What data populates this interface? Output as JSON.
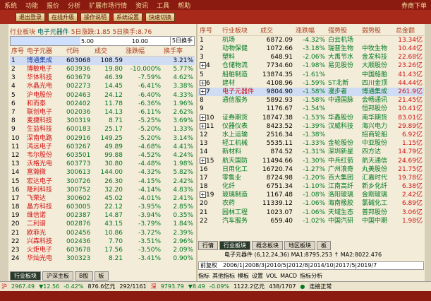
{
  "menubar": {
    "items": [
      "系统",
      "功能",
      "报价",
      "分析",
      "扩展市场行情",
      "资讯",
      "工具",
      "帮助"
    ],
    "right": "券商下单"
  },
  "toolbar": {
    "buttons": [
      "退出登录",
      "在线升级",
      "操作说明",
      "系统设置",
      "快速切换"
    ]
  },
  "left_panel": {
    "title_prefix": "行业板块",
    "title_name": "电子元器件",
    "title_stats": "5日涨跌:1.85 5日换手:8.76",
    "range_lo": "5.00",
    "range_hi": "10.00",
    "range_tag": "5日换手",
    "range_fill": 0.38,
    "headers": [
      "序号",
      "电子元器",
      "代码",
      "成交",
      "涨跌幅",
      "换手率"
    ],
    "rows": [
      [
        "1",
        "博通集成",
        "603068",
        "108.59",
        "",
        "3.21%"
      ],
      [
        "2",
        "博敏电子",
        "603936",
        "19.80",
        "-10.000%",
        "5.77%"
      ],
      [
        "3",
        "华体科技",
        "603679",
        "46.39",
        "-7.59%",
        "4.62%"
      ],
      [
        "4",
        "水晶光电",
        "002273",
        "14.45",
        "-6.41%",
        "3.38%"
      ],
      [
        "5",
        "沪电股份",
        "002463",
        "24.12",
        "-6.40%",
        "4.33%"
      ],
      [
        "6",
        "和而泰",
        "002402",
        "11.78",
        "-6.36%",
        "1.96%"
      ],
      [
        "7",
        "联创电子",
        "002036",
        "14.13",
        "-6.11%",
        "2.62%"
      ],
      [
        "8",
        "麦捷科技",
        "300319",
        "8.71",
        "-5.25%",
        "3.69%"
      ],
      [
        "9",
        "生益科技",
        "600183",
        "25.17",
        "-5.20%",
        "1.33%"
      ],
      [
        "10",
        "深南电路",
        "002916",
        "149.25",
        "-5.20%",
        "3.14%"
      ],
      [
        "11",
        "鸿远电子",
        "603267",
        "49.89",
        "-4.68%",
        "4.41%"
      ],
      [
        "12",
        "韦尔股份",
        "603501",
        "99.88",
        "-4.52%",
        "4.24%"
      ],
      [
        "13",
        "沃格光电",
        "603773",
        "30.80",
        "-4.48%",
        "1.98%"
      ],
      [
        "14",
        "富瀚微",
        "300613",
        "144.00",
        "-4.32%",
        "5.82%"
      ],
      [
        "15",
        "宏达电子",
        "300726",
        "26.30",
        "-4.15%",
        "2.42%"
      ],
      [
        "16",
        "隆利科技",
        "300752",
        "32.20",
        "-4.14%",
        "4.83%"
      ],
      [
        "17",
        "飞荣达",
        "300602",
        "45.02",
        "-4.01%",
        "2.41%"
      ],
      [
        "18",
        "晶方科技",
        "603005",
        "22.12",
        "-3.95%",
        "2.85%"
      ],
      [
        "19",
        "维信诺",
        "002387",
        "14.87",
        "-3.94%",
        "0.35%"
      ],
      [
        "20",
        "二利谱",
        "002876",
        "43.15",
        "-3.79%",
        "1.84%"
      ],
      [
        "21",
        "欧菲光",
        "002456",
        "10.86",
        "-3.72%",
        "2.39%"
      ],
      [
        "22",
        "兴森科技",
        "002436",
        "7.70",
        "-3.51%",
        "2.96%"
      ],
      [
        "23",
        "火炬电子",
        "603678",
        "17.56",
        "-3.50%",
        "2.09%"
      ],
      [
        "24",
        "华灿光电",
        "300323",
        "8.21",
        "-3.41%",
        "0.90%"
      ]
    ],
    "tabs": [
      "行业板块",
      "沪深主板",
      "B股",
      "板"
    ]
  },
  "right_panel": {
    "headers": [
      "序号",
      "行业板块",
      "成交",
      "涨跌幅",
      "强势股",
      "弱势股",
      "总金额"
    ],
    "rows": [
      [
        "1",
        "机场",
        "6872.09",
        "-4.32%",
        "白云机场",
        "",
        "13.34亿"
      ],
      [
        "2",
        "动物保健",
        "1072.66",
        "-3.18%",
        "瑞普生物",
        "中牧生物",
        "10.44亿"
      ],
      [
        "3",
        "塑料",
        "648.91",
        "-2.06%",
        "大禹节水",
        "金发科技",
        "22.68亿"
      ],
      [
        "4",
        "仓储物流",
        "7734.60",
        "-1.98%",
        "易见股份",
        "大顺股份",
        "23.26亿"
      ],
      [
        "5",
        "船舶制造",
        "13874.35",
        "-1.61%",
        "",
        "中国船舶",
        "41.43亿"
      ],
      [
        "6",
        "建材",
        "4108.96",
        "-1.59%",
        "ST北新",
        "四川金顶",
        "44.44亿"
      ],
      [
        "7",
        "电子元器件",
        "9804.90",
        "-1.58%",
        "漫步者",
        "博通集成",
        "261.9亿"
      ],
      [
        "8",
        "通信服务",
        "5892.93",
        "-1.58%",
        "中通国脉",
        "会畅通讯",
        "21.45亿"
      ],
      [
        "9",
        "",
        "1176.67",
        "-1.54%",
        "",
        "恒邦股份",
        "10.41亿"
      ],
      [
        "10",
        "证券期货",
        "18747.38",
        "-1.53%",
        "华鑫股份",
        "南华期货",
        "83.01亿"
      ],
      [
        "11",
        "仪器仪表",
        "8423.52",
        "-1.39%",
        "汉威科技",
        "海兴电力",
        "29.89亿"
      ],
      [
        "12",
        "水上运输",
        "2516.34",
        "-1.38%",
        "",
        "招商轮船",
        "6.92亿"
      ],
      [
        "13",
        "轻工机械",
        "5535.11",
        "-1.33%",
        "金轮股份",
        "中亚股份",
        "1.15亿"
      ],
      [
        "14",
        "新材料",
        "874.52",
        "-1.31%",
        "深圳新星",
        "四方达",
        "14.79亿"
      ],
      [
        "15",
        "航天国防",
        "11494.66",
        "-1.30%",
        "中兵红箭",
        "航天通信",
        "24.69亿"
      ],
      [
        "16",
        "日用化工",
        "16720.74",
        "-1.27%",
        "广州浪奇",
        "丸美股份",
        "21.75亿"
      ],
      [
        "17",
        "零售业",
        "8724.98",
        "-1.20%",
        "百大集团",
        "汇嘉时代",
        "19.78亿"
      ],
      [
        "18",
        "化纤",
        "6751.34",
        "-1.10%",
        "江南高纤",
        "新乡化纤",
        "6.38亿"
      ],
      [
        "19",
        "玻璃制造",
        "1167.48",
        "-1.08%",
        "洛阳玻璃",
        "金刚玻璃",
        "2.42亿"
      ],
      [
        "20",
        "农药",
        "11339.12",
        "-1.06%",
        "海南橡胶",
        "氯碱化工",
        "6.89亿"
      ],
      [
        "21",
        "园林工程",
        "1023.07",
        "-1.06%",
        "天域生态",
        "普邦股份",
        "3.06亿"
      ],
      [
        "22",
        "汽车服务",
        "659.40",
        "-1.02%",
        "中国汽研",
        "中国中期",
        "1.98亿"
      ]
    ],
    "tabs": [
      "行情",
      "行业板块",
      "概念板块",
      "地区板块",
      "板"
    ],
    "chart_info": "电子元器件  (6,12,24,36)  MA1:8795.253 ↑  MA2:8022.476",
    "timeline_label": "前复权",
    "timeline": "2006/1|2008/3|2010/5|2012/8|2014/10|2017/5|2019/7",
    "indicators": [
      "指标",
      "其他指标",
      "模板",
      "设置",
      "VOL",
      "MACD",
      "指标分析"
    ]
  },
  "status": {
    "items": [
      "沪",
      "2967.49",
      "▼12.56",
      "-0.42%",
      "876.6亿元",
      "292/1161",
      "深",
      "9793.79",
      "▼8.49",
      "-0.09%",
      "1122.2亿元",
      "438/1707",
      "连接正常"
    ],
    "icon": "connection-icon"
  },
  "colors": {
    "up": "#d41010",
    "down": "#007a20",
    "accent": "#8b1a10"
  }
}
